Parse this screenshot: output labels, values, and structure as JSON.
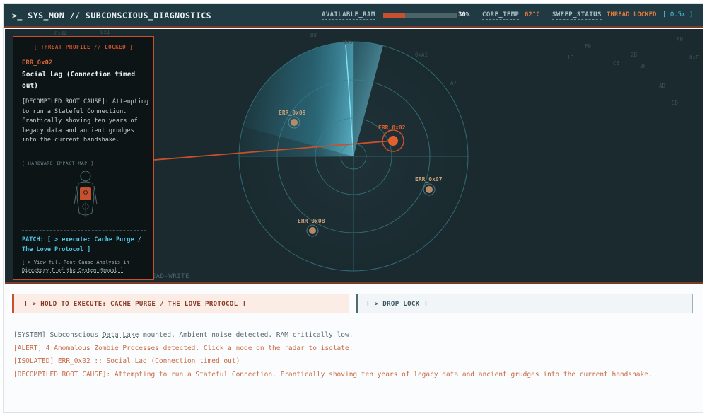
{
  "header": {
    "title": ">_ SYS_MON // SUBCONSCIOUS_DIAGNOSTICS",
    "ram_label": "AVAILABLE_RAM",
    "ram_value": "30%",
    "ram_fraction": 0.3,
    "temp_label": "CORE_TEMP",
    "temp_value": "62°C",
    "sweep_label": "SWEEP_STATUS",
    "sweep_value": "THREAD LOCKED",
    "sweep_speed": "[ 0.5x ]"
  },
  "radar": {
    "mode_label": "D READ-WRITE",
    "hex_labels": [
      "0x4A",
      "0x1",
      "B8",
      "0x5",
      "0xA1",
      "A7",
      "F0",
      "1E",
      "2B",
      "C5",
      "3F",
      "AD",
      "A0",
      "0xE",
      "9D"
    ],
    "nodes": [
      {
        "id": "ERR_0x09",
        "status": "idle"
      },
      {
        "id": "ERR_0x02",
        "status": "locked"
      },
      {
        "id": "ERR_0x07",
        "status": "idle"
      },
      {
        "id": "ERR_0x08",
        "status": "idle"
      }
    ]
  },
  "threat_panel": {
    "heading": "[ THREAT PROFILE // LOCKED ]",
    "error_id": "ERR_0x02",
    "title": "Social Lag (Connection timed out)",
    "root_cause": "[DECOMPILED ROOT CAUSE]: Attempting to run a Stateful Connection. Frantically shoving ten years of legacy data and ancient grudges into the current handshake.",
    "hardware_label": "[ HARDWARE IMPACT MAP ]",
    "patch": "PATCH: [ > execute: Cache Purge / The Love Protocol ]",
    "manual_link": "[ > View full Root Cause Analysis in Directory F of the System Manual ]"
  },
  "actions": {
    "execute_label": "[ > HOLD TO EXECUTE: CACHE PURGE / THE LOVE PROTOCOL ]",
    "drop_label": "[ > DROP LOCK ]"
  },
  "log": {
    "line1_prefix": "[SYSTEM] Subconscious ",
    "line1_link": "Data Lake",
    "line1_suffix": " mounted. Ambient noise detected. RAM critically low.",
    "line2": "[ALERT] 4 Anomalous Zombie Processes detected. Click a node on the radar to isolate.",
    "line3": "[ISOLATED] ERR_0x02 :: Social Lag (Connection timed out)",
    "line4": "[DECOMPILED ROOT CAUSE]: Attempting to run a Stateful Connection. Frantically shoving ten years of legacy data and ancient grudges into the current handshake."
  },
  "colors": {
    "accent": "#c9502c",
    "cyan": "#4ec3e0",
    "node_idle": "#b58a68",
    "header_bg": "#1f3a42",
    "radar_bg": "#1a2a2f"
  }
}
